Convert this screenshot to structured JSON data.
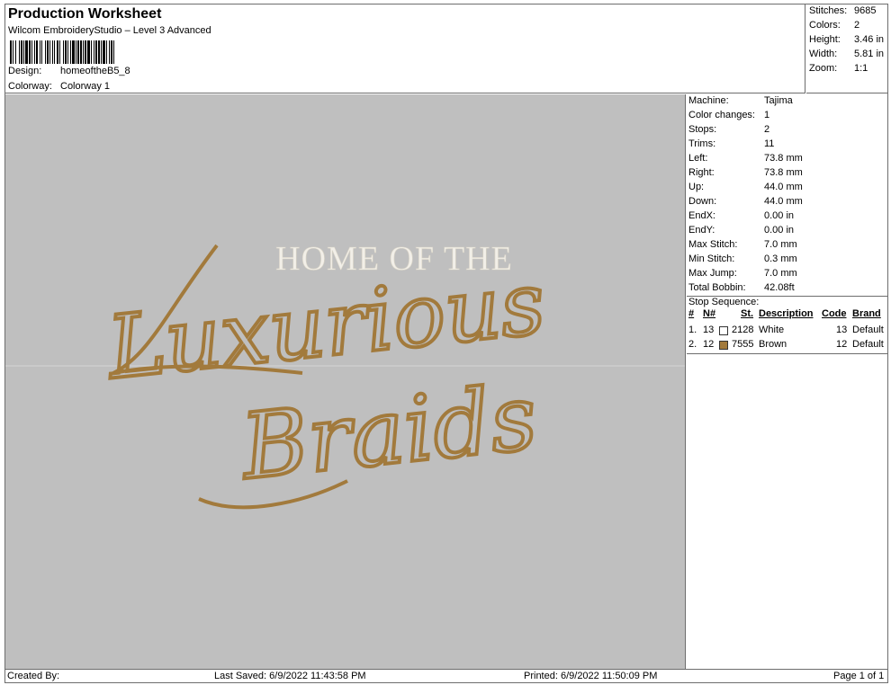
{
  "header": {
    "title": "Production Worksheet",
    "subtitle": "Wilcom EmbroideryStudio – Level 3 Advanced",
    "design_label": "Design:",
    "design_value": "homeoftheB5_8",
    "colorway_label": "Colorway:",
    "colorway_value": "Colorway 1"
  },
  "summary": [
    {
      "label": "Stitches:",
      "value": "9685"
    },
    {
      "label": "Colors:",
      "value": "2"
    },
    {
      "label": "Height:",
      "value": "3.46 in"
    },
    {
      "label": "Width:",
      "value": "5.81 in"
    },
    {
      "label": "Zoom:",
      "value": "1:1"
    }
  ],
  "design_preview": {
    "line1": "HOME OF THE",
    "line2": "Luxurious",
    "line3": "Braids",
    "thread_white": "#f2efe8",
    "thread_brown": "#a27a3c",
    "background": "#bfbfbf"
  },
  "machine_info": [
    {
      "label": "Machine:",
      "value": "Tajima"
    },
    {
      "label": "Color changes:",
      "value": "1"
    },
    {
      "label": "Stops:",
      "value": "2"
    },
    {
      "label": "Trims:",
      "value": "11"
    },
    {
      "label": "Left:",
      "value": "73.8 mm"
    },
    {
      "label": "Right:",
      "value": "73.8 mm"
    },
    {
      "label": "Up:",
      "value": "44.0 mm"
    },
    {
      "label": "Down:",
      "value": "44.0 mm"
    },
    {
      "label": "EndX:",
      "value": "0.00 in"
    },
    {
      "label": "EndY:",
      "value": "0.00 in"
    },
    {
      "label": "Max Stitch:",
      "value": "7.0 mm"
    },
    {
      "label": "Min Stitch:",
      "value": "0.3 mm"
    },
    {
      "label": "Max Jump:",
      "value": "7.0 mm"
    },
    {
      "label": "Total Bobbin:",
      "value": "42.08ft"
    }
  ],
  "stop_sequence": {
    "label": "Stop Sequence:",
    "columns": [
      "#",
      "N#",
      "St.",
      "Description",
      "Code",
      "Brand"
    ],
    "rows": [
      {
        "num": "1.",
        "n": "13",
        "swatch": "#ffffff",
        "st": "2128",
        "description": "White",
        "code": "13",
        "brand": "Default"
      },
      {
        "num": "2.",
        "n": "12",
        "swatch": "#a27a3c",
        "st": "7555",
        "description": "Brown",
        "code": "12",
        "brand": "Default"
      }
    ]
  },
  "footer": {
    "created_by": "Created By:",
    "last_saved": "Last Saved: 6/9/2022 11:43:58 PM",
    "printed": "Printed: 6/9/2022 11:50:09 PM",
    "page": "Page 1 of 1"
  }
}
